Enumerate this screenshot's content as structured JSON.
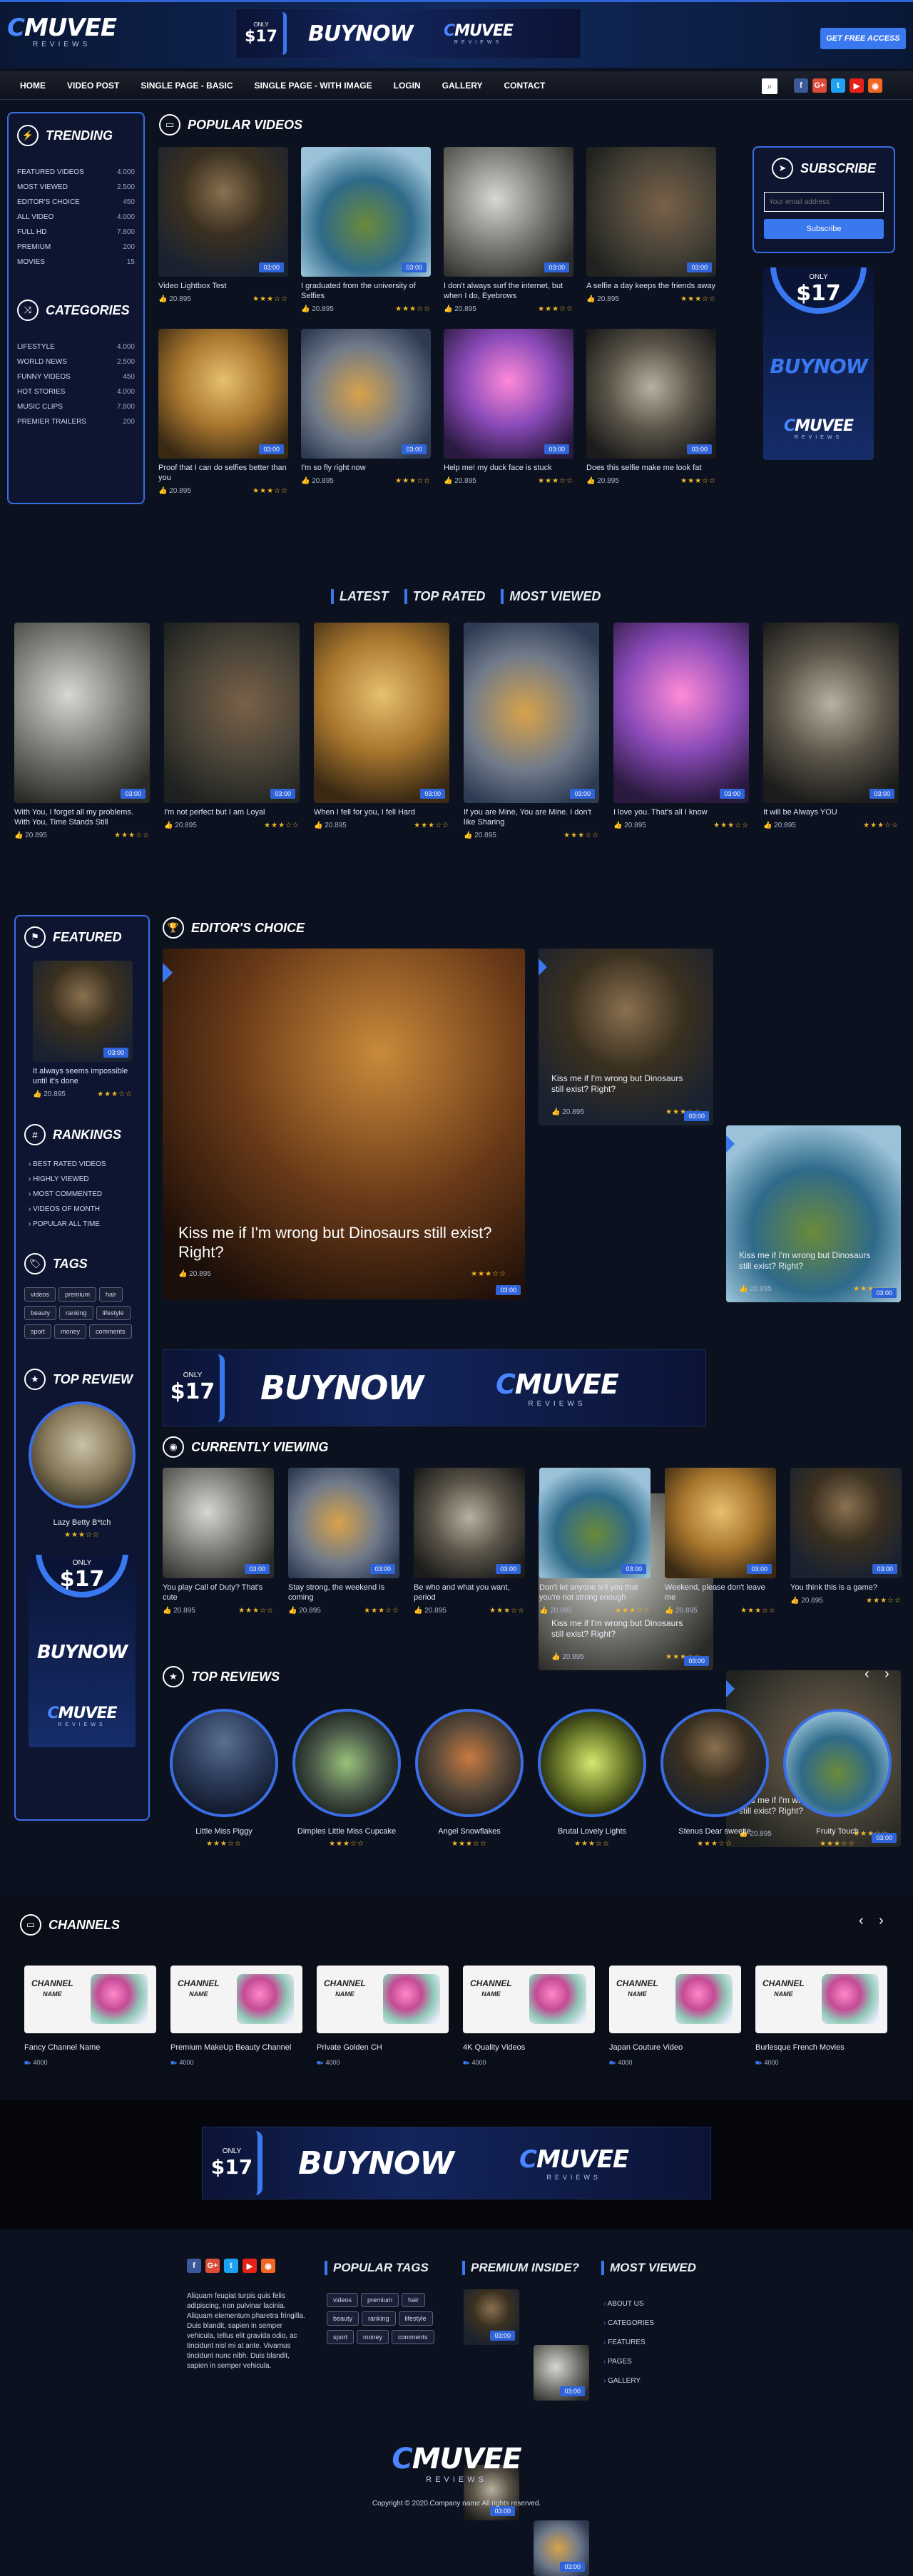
{
  "brand": {
    "logo_big_1": "C",
    "logo_big_2": "MUVEE",
    "logo_small": "REVIEWS"
  },
  "header": {
    "price_only": "ONLY",
    "price": "$17",
    "buy": "BUYNOW",
    "cta": "GET FREE ACCESS"
  },
  "nav": {
    "items": [
      "HOME",
      "VIDEO POST",
      "SINGLE PAGE - BASIC",
      "SINGLE PAGE - WITH IMAGE",
      "LOGIN",
      "GALLERY",
      "CONTACT"
    ],
    "search_icon": "search-icon"
  },
  "social": [
    {
      "name": "facebook",
      "glyph": "f",
      "color": "#3b5998"
    },
    {
      "name": "google",
      "glyph": "G+",
      "color": "#dd4b39"
    },
    {
      "name": "twitter",
      "glyph": "t",
      "color": "#1da1f2"
    },
    {
      "name": "youtube",
      "glyph": "▶",
      "color": "#e62117"
    },
    {
      "name": "rss",
      "glyph": "◉",
      "color": "#f26522"
    }
  ],
  "trending": {
    "title": "TRENDING",
    "items": [
      [
        "FEATURED VIDEOS",
        "4.000"
      ],
      [
        "MOST VIEWED",
        "2.500"
      ],
      [
        "EDITOR'S CHOICE",
        "450"
      ],
      [
        "ALL VIDEO",
        "4.000"
      ],
      [
        "FULL HD",
        "7.800"
      ],
      [
        "PREMIUM",
        "200"
      ],
      [
        "MOVIES",
        "15"
      ]
    ]
  },
  "categories": {
    "title": "CATEGORIES",
    "items": [
      [
        "LIFESTYLE",
        "4.000"
      ],
      [
        "WORLD NEWS",
        "2.500"
      ],
      [
        "FUNNY VIDEOS",
        "450"
      ],
      [
        "HOT STORIES",
        "4.000"
      ],
      [
        "MUSIC CLIPS",
        "7.800"
      ],
      [
        "PREMIER TRAILERS",
        "200"
      ]
    ]
  },
  "popular": {
    "title": "POPULAR VIDEOS",
    "items": [
      {
        "t": "Video Lightbox Test",
        "v": "20.895",
        "d": "03:00"
      },
      {
        "t": "I graduated from the university of Selfies",
        "v": "20.895",
        "d": "03:00"
      },
      {
        "t": "I don't always surf the internet, but when I do, Eyebrows",
        "v": "20.895",
        "d": "03:00"
      },
      {
        "t": "A selfie a day keeps the friends away",
        "v": "20.895",
        "d": "03:00"
      },
      {
        "t": "Proof that I can do selfies better than you",
        "v": "20.895",
        "d": "03:00"
      },
      {
        "t": "I'm so fly right now",
        "v": "20.895",
        "d": "03:00"
      },
      {
        "t": "Help me! my duck face is stuck",
        "v": "20.895",
        "d": "03:00"
      },
      {
        "t": "Does this selfie make me look fat",
        "v": "20.895",
        "d": "03:00"
      }
    ]
  },
  "subscribe": {
    "title": "SUBSCRIBE",
    "placeholder": "Your email address",
    "button": "Subscribe"
  },
  "tabs": [
    "LATEST",
    "TOP RATED",
    "MOST VIEWED"
  ],
  "latest": [
    {
      "t": "With You, I forget all my problems. With You, Time Stands Still",
      "v": "20.895",
      "d": "03:00"
    },
    {
      "t": "I'm not perfect but I am Loyal",
      "v": "20.895",
      "d": "03:00"
    },
    {
      "t": "When I fell for you, I fell Hard",
      "v": "20.895",
      "d": "03:00"
    },
    {
      "t": "If you are Mine, You are Mine. I don't like Sharing",
      "v": "20.895",
      "d": "03:00"
    },
    {
      "t": "I love you. That's all I know",
      "v": "20.895",
      "d": "03:00"
    },
    {
      "t": "It will be Always YOU",
      "v": "20.895",
      "d": "03:00"
    }
  ],
  "featured": {
    "title": "FEATURED",
    "video": {
      "t": "It always seems impossible until it's done",
      "v": "20.895",
      "d": "03:00"
    }
  },
  "rankings": {
    "title": "RANKINGS",
    "items": [
      "BEST RATED VIDEOS",
      "HIGHLY VIEWED",
      "MOST COMMENTED",
      "VIDEOS OF MONTH",
      "POPULAR ALL TIME"
    ]
  },
  "tags": {
    "title": "TAGS",
    "items": [
      "videos",
      "premium",
      "hair",
      "beauty",
      "ranking",
      "lifestyle",
      "sport",
      "money",
      "comments"
    ]
  },
  "top_review": {
    "title": "TOP REVIEW",
    "name": "Lazy Betty B*tch"
  },
  "editors": {
    "title": "EDITOR'S CHOICE",
    "main": {
      "t": "Kiss me if I'm wrong but Dinosaurs still exist? Right?",
      "v": "20.895",
      "d": "03:00"
    },
    "items": [
      {
        "t": "Kiss me if I'm wrong but Dinosaurs still exist? Right?",
        "v": "20.895",
        "d": "03:00"
      },
      {
        "t": "Kiss me if I'm wrong but Dinosaurs still exist? Right?",
        "v": "20.895",
        "d": "03:00"
      },
      {
        "t": "Kiss me if I'm wrong but Dinosaurs still exist? Right?",
        "v": "20.895",
        "d": "03:00"
      },
      {
        "t": "Kiss me if I'm wrong but Dinosaurs still exist? Right?",
        "v": "20.895",
        "d": "03:00"
      }
    ]
  },
  "current": {
    "title": "CURRENTLY VIEWING",
    "items": [
      {
        "t": "You play Call of Duty? That's cute",
        "v": "20.895",
        "d": "03:00"
      },
      {
        "t": "Stay strong, the weekend is coming",
        "v": "20.895",
        "d": "03:00"
      },
      {
        "t": "Be who and what you want, period",
        "v": "20.895",
        "d": "03:00"
      },
      {
        "t": "Don't let anyone tell you that you're not strong enough",
        "v": "20.895",
        "d": "03:00"
      },
      {
        "t": "Weekend, please don't leave me",
        "v": "20.895",
        "d": "03:00"
      },
      {
        "t": "You think this is a game?",
        "v": "20.895",
        "d": "03:00"
      }
    ]
  },
  "reviews": {
    "title": "TOP REVIEWS",
    "items": [
      "Little Miss Piggy",
      "Dimples Little Miss Cupcake",
      "Angel Snowflakes",
      "Brutal Lovely Lights",
      "Stenus Dear sweetie",
      "Fruity Touch"
    ]
  },
  "channels": {
    "title": "CHANNELS",
    "card_label_1": "CHANNEL",
    "card_label_2": "NAME",
    "items": [
      [
        "Fancy Channel Name",
        "4000"
      ],
      [
        "Premium MakeUp Beauty Channel",
        "4000"
      ],
      [
        "Private Golden CH",
        "4000"
      ],
      [
        "4K Quality Videos",
        "4000"
      ],
      [
        "Japan Couture Video",
        "4000"
      ],
      [
        "Burlesque French Movies",
        "4000"
      ]
    ]
  },
  "footer": {
    "about": "Aliquam feugiat turpis quis felis adipiscing, non pulvinar lacinia. Aliquam elementum pharetra fringilla. Duis blandit, sapien in semper vehicula, tellus elit gravida odio, ac tincidunt nisl mi at ante. Vivamus tincidunt nunc nibh. Duis blandit, sapien in semper vehicula.",
    "popular_tags_title": "POPULAR TAGS",
    "tags": [
      "videos",
      "premium",
      "hair",
      "beauty",
      "ranking",
      "lifestyle",
      "sport",
      "money",
      "comments"
    ],
    "premium_title": "PREMIUM INSIDE?",
    "viewed_title": "MOST VIEWED",
    "links": [
      "ABOUT US",
      "CATEGORIES",
      "FEATURES",
      "PAGES",
      "GALLERY"
    ],
    "copyright": "Copyright © 2020.Company name All rights reserved."
  }
}
